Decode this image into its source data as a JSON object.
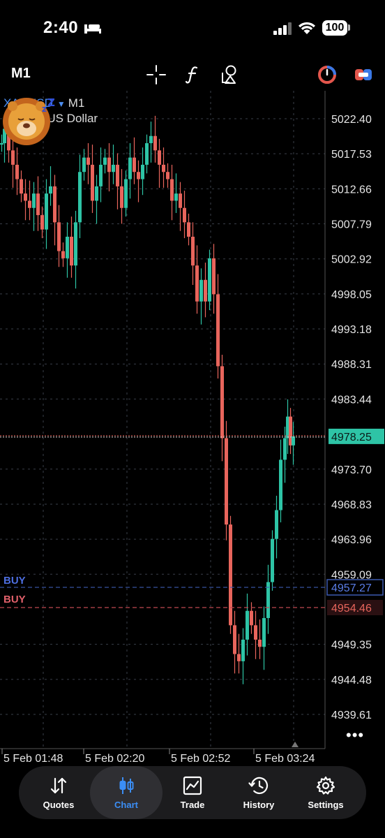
{
  "status": {
    "time": "2:40",
    "battery": "100"
  },
  "toolbar": {
    "timeframe": "M1"
  },
  "chart": {
    "symbol": "XAUUSD",
    "timeframe": "M1",
    "description": "Gold vs US Dollar",
    "current_price": "4978.25",
    "buy_price": "4957.27",
    "sell_price": "4954.46",
    "buy_label_1": "BUY",
    "buy_label_2": "BUY",
    "price_ticks": [
      "5022.40",
      "5017.53",
      "5012.66",
      "5007.79",
      "5002.92",
      "4998.05",
      "4993.18",
      "4988.31",
      "4983.44",
      "4973.70",
      "4968.83",
      "4963.96",
      "4959.09",
      "4949.35",
      "4944.48",
      "4939.61"
    ],
    "time_ticks": [
      "5 Feb 01:48",
      "5 Feb 02:20",
      "5 Feb 02:52",
      "5 Feb 03:24"
    ],
    "colors": {
      "up": "#2ec4a6",
      "down": "#e8655c",
      "grid": "#3a3f4a",
      "buy_line": "#3d5ab0",
      "sell_line": "#c0484f"
    }
  },
  "tabs": [
    {
      "label": "Quotes",
      "icon": "quotes-arrows-icon"
    },
    {
      "label": "Chart",
      "icon": "candlestick-icon",
      "active": true
    },
    {
      "label": "Trade",
      "icon": "trade-chart-icon"
    },
    {
      "label": "History",
      "icon": "history-clock-icon"
    },
    {
      "label": "Settings",
      "icon": "gear-icon"
    }
  ]
}
